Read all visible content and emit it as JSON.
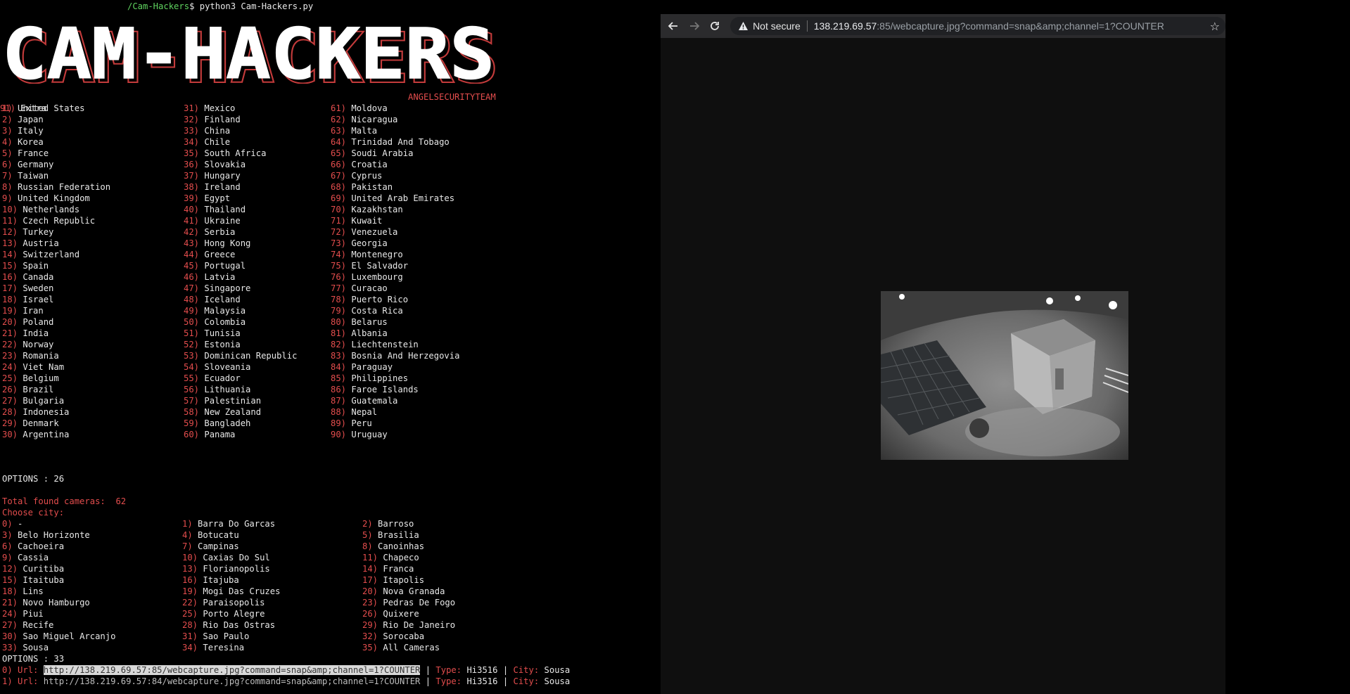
{
  "terminal": {
    "prompt_path": "/Cam-Hackers",
    "prompt_cmd": "$ python3 Cam-Hackers.py",
    "banner_text": "CAM-HACKERS",
    "team": "ANGELSECURITYTEAM",
    "countries": [
      [
        "1)",
        "United States"
      ],
      [
        "2)",
        "Japan"
      ],
      [
        "3)",
        "Italy"
      ],
      [
        "4)",
        "Korea"
      ],
      [
        "5)",
        "France"
      ],
      [
        "6)",
        "Germany"
      ],
      [
        "7)",
        "Taiwan"
      ],
      [
        "8)",
        "Russian Federation"
      ],
      [
        "9)",
        "United Kingdom"
      ],
      [
        "10)",
        "Netherlands"
      ],
      [
        "11)",
        "Czech Republic"
      ],
      [
        "12)",
        "Turkey"
      ],
      [
        "13)",
        "Austria"
      ],
      [
        "14)",
        "Switzerland"
      ],
      [
        "15)",
        "Spain"
      ],
      [
        "16)",
        "Canada"
      ],
      [
        "17)",
        "Sweden"
      ],
      [
        "18)",
        "Israel"
      ],
      [
        "19)",
        "Iran"
      ],
      [
        "20)",
        "Poland"
      ],
      [
        "21)",
        "India"
      ],
      [
        "22)",
        "Norway"
      ],
      [
        "23)",
        "Romania"
      ],
      [
        "24)",
        "Viet Nam"
      ],
      [
        "25)",
        "Belgium"
      ],
      [
        "26)",
        "Brazil"
      ],
      [
        "27)",
        "Bulgaria"
      ],
      [
        "28)",
        "Indonesia"
      ],
      [
        "29)",
        "Denmark"
      ],
      [
        "30)",
        "Argentina"
      ],
      [
        "31)",
        "Mexico"
      ],
      [
        "32)",
        "Finland"
      ],
      [
        "33)",
        "China"
      ],
      [
        "34)",
        "Chile"
      ],
      [
        "35)",
        "South Africa"
      ],
      [
        "36)",
        "Slovakia"
      ],
      [
        "37)",
        "Hungary"
      ],
      [
        "38)",
        "Ireland"
      ],
      [
        "39)",
        "Egypt"
      ],
      [
        "40)",
        "Thailand"
      ],
      [
        "41)",
        "Ukraine"
      ],
      [
        "42)",
        "Serbia"
      ],
      [
        "43)",
        "Hong Kong"
      ],
      [
        "44)",
        "Greece"
      ],
      [
        "45)",
        "Portugal"
      ],
      [
        "46)",
        "Latvia"
      ],
      [
        "47)",
        "Singapore"
      ],
      [
        "48)",
        "Iceland"
      ],
      [
        "49)",
        "Malaysia"
      ],
      [
        "50)",
        "Colombia"
      ],
      [
        "51)",
        "Tunisia"
      ],
      [
        "52)",
        "Estonia"
      ],
      [
        "53)",
        "Dominican Republic"
      ],
      [
        "54)",
        "Sloveania"
      ],
      [
        "55)",
        "Ecuador"
      ],
      [
        "56)",
        "Lithuania"
      ],
      [
        "57)",
        "Palestinian"
      ],
      [
        "58)",
        "New Zealand"
      ],
      [
        "59)",
        "Bangladeh"
      ],
      [
        "60)",
        "Panama"
      ],
      [
        "61)",
        "Moldova"
      ],
      [
        "62)",
        "Nicaragua"
      ],
      [
        "63)",
        "Malta"
      ],
      [
        "64)",
        "Trinidad And Tobago"
      ],
      [
        "65)",
        "Soudi Arabia"
      ],
      [
        "66)",
        "Croatia"
      ],
      [
        "67)",
        "Cyprus"
      ],
      [
        "68)",
        "Pakistan"
      ],
      [
        "69)",
        "United Arab Emirates"
      ],
      [
        "70)",
        "Kazakhstan"
      ],
      [
        "71)",
        "Kuwait"
      ],
      [
        "72)",
        "Venezuela"
      ],
      [
        "73)",
        "Georgia"
      ],
      [
        "74)",
        "Montenegro"
      ],
      [
        "75)",
        "El Salvador"
      ],
      [
        "76)",
        "Luxembourg"
      ],
      [
        "77)",
        "Curacao"
      ],
      [
        "78)",
        "Puerto Rico"
      ],
      [
        "79)",
        "Costa Rica"
      ],
      [
        "80)",
        "Belarus"
      ],
      [
        "81)",
        "Albania"
      ],
      [
        "82)",
        "Liechtenstein"
      ],
      [
        "83)",
        "Bosnia And Herzegovia"
      ],
      [
        "84)",
        "Paraguay"
      ],
      [
        "85)",
        "Philippines"
      ],
      [
        "86)",
        "Faroe Islands"
      ],
      [
        "87)",
        "Guatemala"
      ],
      [
        "88)",
        "Nepal"
      ],
      [
        "89)",
        "Peru"
      ],
      [
        "90)",
        "Uruguay"
      ],
      [
        "91)",
        "Extra"
      ]
    ],
    "options_label": "OPTIONS : ",
    "country_option": "26",
    "total_label": "Total found cameras:  ",
    "total_value": "62",
    "choose_city": "Choose city:",
    "cities": [
      [
        "0)",
        "-"
      ],
      [
        "1)",
        "Barra Do Garcas"
      ],
      [
        "2)",
        "Barroso"
      ],
      [
        "3)",
        "Belo Horizonte"
      ],
      [
        "4)",
        "Botucatu"
      ],
      [
        "5)",
        "Brasilia"
      ],
      [
        "6)",
        "Cachoeira"
      ],
      [
        "7)",
        "Campinas"
      ],
      [
        "8)",
        "Canoinhas"
      ],
      [
        "9)",
        "Cassia"
      ],
      [
        "10)",
        "Caxias Do Sul"
      ],
      [
        "11)",
        "Chapeco"
      ],
      [
        "12)",
        "Curitiba"
      ],
      [
        "13)",
        "Florianopolis"
      ],
      [
        "14)",
        "Franca"
      ],
      [
        "15)",
        "Itaituba"
      ],
      [
        "16)",
        "Itajuba"
      ],
      [
        "17)",
        "Itapolis"
      ],
      [
        "18)",
        "Lins"
      ],
      [
        "19)",
        "Mogi Das Cruzes"
      ],
      [
        "20)",
        "Nova Granada"
      ],
      [
        "21)",
        "Novo Hamburgo"
      ],
      [
        "22)",
        "Paraisopolis"
      ],
      [
        "23)",
        "Pedras De Fogo"
      ],
      [
        "24)",
        "Piui"
      ],
      [
        "25)",
        "Porto Alegre"
      ],
      [
        "26)",
        "Quixere"
      ],
      [
        "27)",
        "Recife"
      ],
      [
        "28)",
        "Rio Das Ostras"
      ],
      [
        "29)",
        "Rio De Janeiro"
      ],
      [
        "30)",
        "Sao Miguel Arcanjo"
      ],
      [
        "31)",
        "Sao Paulo"
      ],
      [
        "32)",
        "Sorocaba"
      ],
      [
        "33)",
        "Sousa"
      ],
      [
        "34)",
        "Teresina"
      ],
      [
        "35)",
        "All Cameras"
      ]
    ],
    "city_option": "33",
    "results": [
      {
        "idx": "0)",
        "url_label": "Url:",
        "url": "http://138.219.69.57:85/webcapture.jpg?command=snap&amp;channel=1?COUNTER",
        "type_label": "Type:",
        "type": "Hi3516",
        "city_label": "City:",
        "city": "Sousa"
      },
      {
        "idx": "1)",
        "url_label": "Url:",
        "url": "http://138.219.69.57:84/webcapture.jpg?command=snap&amp;channel=1?COUNTER",
        "type_label": "Type:",
        "type": "Hi3516",
        "city_label": "City:",
        "city": "Sousa"
      }
    ],
    "pipe": "|"
  },
  "browser": {
    "security_label": "Not secure",
    "url_host": "138.219.69.57",
    "url_rest": ":85/webcapture.jpg?command=snap&amp;channel=1?COUNTER",
    "icons": [
      "back-arrow-icon",
      "forward-arrow-icon",
      "reload-icon",
      "warning-icon",
      "star-icon"
    ]
  },
  "colors": {
    "accent_red": "#e34d4d",
    "prompt_green": "#5fd35f",
    "background": "#000000"
  }
}
